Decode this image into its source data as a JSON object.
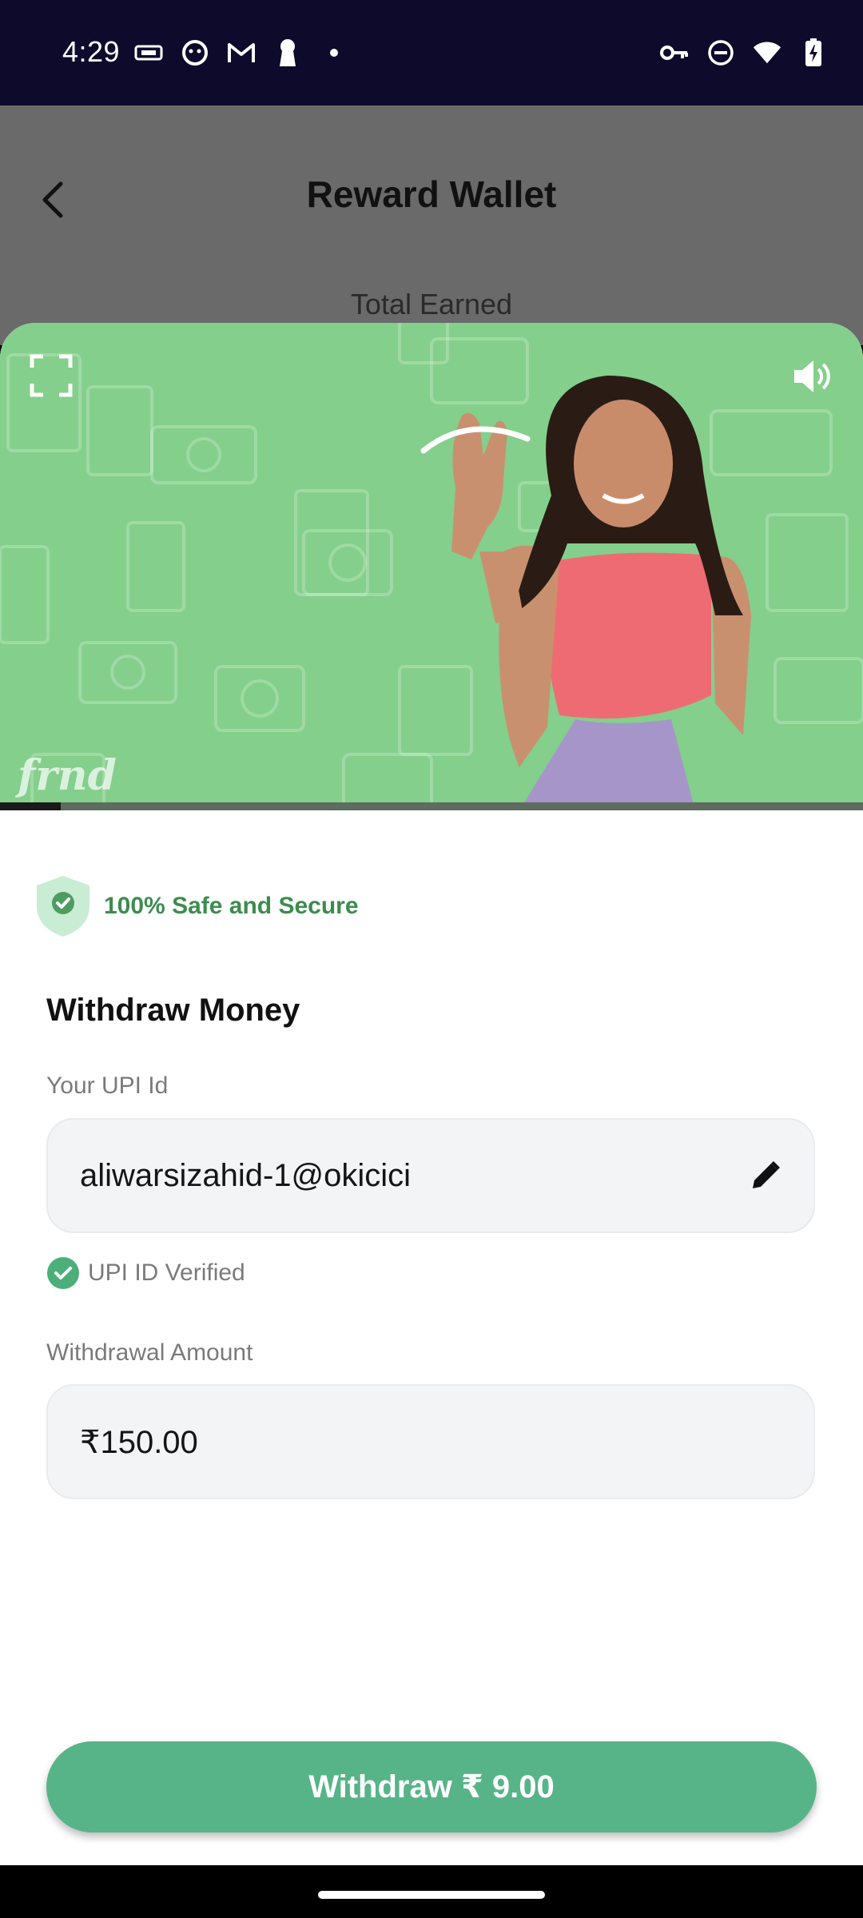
{
  "status_bar": {
    "time": "4:29",
    "left_icons": [
      "tag-icon",
      "notification-app-icon",
      "gmail-icon",
      "keyhole-icon",
      "dot-icon"
    ],
    "right_icons": [
      "vpn-key-icon",
      "dnd-icon",
      "wifi-icon",
      "battery-charging-icon"
    ]
  },
  "background_page": {
    "title": "Reward Wallet",
    "subtitle": "Total Earned"
  },
  "video": {
    "brand": "frnd",
    "progress": 0.07,
    "background_color": "#84cf8c"
  },
  "security": {
    "label": "100% Safe and Secure"
  },
  "withdraw_form": {
    "title": "Withdraw Money",
    "upi_label": "Your UPI Id",
    "upi_value": "aliwarsizahid-1@okicici",
    "verified_text": "UPI ID Verified",
    "amount_label": "Withdrawal Amount",
    "amount_value": "₹150.00"
  },
  "actions": {
    "withdraw_label": "Withdraw ₹ 9.00"
  },
  "colors": {
    "accent": "#57b488",
    "safe_text": "#3d8c4e",
    "status_bar": "#0e0a2c"
  }
}
